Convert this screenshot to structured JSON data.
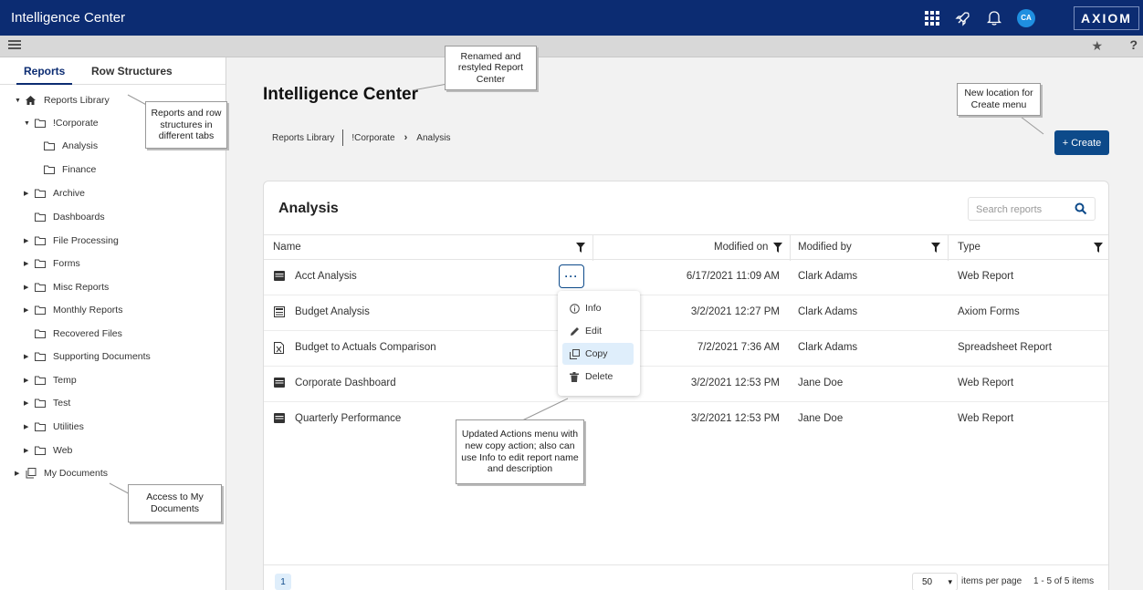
{
  "topbar": {
    "app_title": "Intelligence Center",
    "avatar_initials": "CA",
    "brand": "AXIOM"
  },
  "subbar": {
    "help": "?"
  },
  "sidebar": {
    "tabs": [
      {
        "label": "Reports"
      },
      {
        "label": "Row Structures"
      }
    ],
    "tree": [
      {
        "label": "Reports Library"
      },
      {
        "label": "!Corporate"
      },
      {
        "label": "Analysis"
      },
      {
        "label": "Finance"
      },
      {
        "label": "Archive"
      },
      {
        "label": "Dashboards"
      },
      {
        "label": "File Processing"
      },
      {
        "label": "Forms"
      },
      {
        "label": "Misc Reports"
      },
      {
        "label": "Monthly Reports"
      },
      {
        "label": "Recovered Files"
      },
      {
        "label": "Supporting Documents"
      },
      {
        "label": "Temp"
      },
      {
        "label": "Test"
      },
      {
        "label": "Utilities"
      },
      {
        "label": "Web"
      },
      {
        "label": "My Documents"
      }
    ]
  },
  "main": {
    "title": "Intelligence Center",
    "breadcrumb": [
      "Reports Library",
      "!Corporate",
      "Analysis"
    ],
    "create_label": "+ Create"
  },
  "panel": {
    "title": "Analysis",
    "search_placeholder": "Search reports",
    "columns": [
      "Name",
      "Modified on",
      "Modified by",
      "Type"
    ],
    "rows": [
      {
        "name": "Acct Analysis",
        "modified_on": "6/17/2021 11:09 AM",
        "modified_by": "Clark Adams",
        "type": "Web Report"
      },
      {
        "name": "Budget Analysis",
        "modified_on": "3/2/2021 12:27 PM",
        "modified_by": "Clark Adams",
        "type": "Axiom Forms"
      },
      {
        "name": "Budget to Actuals Comparison",
        "modified_on": "7/2/2021 7:36 AM",
        "modified_by": "Clark Adams",
        "type": "Spreadsheet Report"
      },
      {
        "name": "Corporate Dashboard",
        "modified_on": "3/2/2021 12:53 PM",
        "modified_by": "Jane Doe",
        "type": "Web Report"
      },
      {
        "name": "Quarterly Performance",
        "modified_on": "3/2/2021 12:53 PM",
        "modified_by": "Jane Doe",
        "type": "Web Report"
      }
    ],
    "actions_button": "···",
    "context_menu": [
      {
        "label": "Info"
      },
      {
        "label": "Edit"
      },
      {
        "label": "Copy"
      },
      {
        "label": "Delete"
      }
    ],
    "footer": {
      "page": "1",
      "per_page": "50",
      "per_page_label": "items per page",
      "count_label": "1 - 5 of 5 items"
    }
  },
  "callouts": {
    "renamed": "Renamed and restyled Report Center",
    "tabs": "Reports and row structures in different tabs",
    "create": "New location for Create menu",
    "actions": "Updated Actions menu with new copy action; also can use Info to edit report name and description",
    "mydocs": "Access to My Documents"
  },
  "colors": {
    "topbar": "#0c2c72",
    "accent": "#0d4a8a",
    "highlight": "#dfeefb"
  }
}
